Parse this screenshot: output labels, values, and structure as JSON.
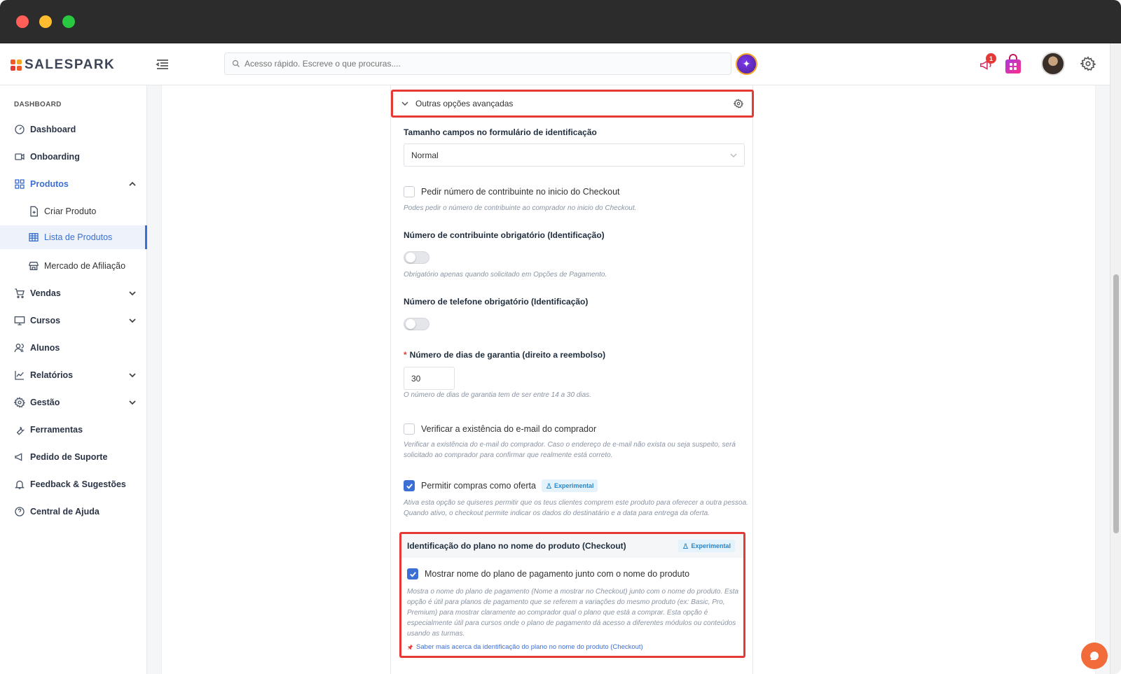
{
  "app": {
    "brand": "SALESPARK"
  },
  "topbar": {
    "search_placeholder": "Acesso rápido. Escreve o que procuras....",
    "notification_count": "1"
  },
  "sidebar": {
    "heading": "DASHBOARD",
    "items": [
      {
        "label": "Dashboard",
        "icon": "dashboard-icon"
      },
      {
        "label": "Onboarding",
        "icon": "video-icon"
      },
      {
        "label": "Produtos",
        "icon": "grid-icon",
        "expanded": true
      },
      {
        "label": "Criar Produto",
        "icon": "file-plus-icon"
      },
      {
        "label": "Lista de Produtos",
        "icon": "table-icon",
        "selected": true
      },
      {
        "label": "Mercado de Afiliação",
        "icon": "store-icon"
      },
      {
        "label": "Vendas",
        "icon": "cart-icon"
      },
      {
        "label": "Cursos",
        "icon": "monitor-icon"
      },
      {
        "label": "Alunos",
        "icon": "users-icon"
      },
      {
        "label": "Relatórios",
        "icon": "chart-icon"
      },
      {
        "label": "Gestão",
        "icon": "gear-icon"
      },
      {
        "label": "Ferramentas",
        "icon": "wrench-icon"
      },
      {
        "label": "Pedido de Suporte",
        "icon": "megaphone-icon"
      },
      {
        "label": "Feedback & Sugestões",
        "icon": "bell-icon"
      },
      {
        "label": "Central de Ajuda",
        "icon": "help-icon"
      }
    ]
  },
  "form": {
    "section_title": "Outras opções avançadas",
    "field_size": {
      "label": "Tamanho campos no formulário de identificação",
      "value": "Normal"
    },
    "ask_tax_number": {
      "label": "Pedir número de contribuinte no inicio do Checkout",
      "checked": false,
      "help": "Podes pedir o número de contribuinte ao comprador no inicio do Checkout."
    },
    "tax_required": {
      "label": "Número de contribuinte obrigatório (Identificação)",
      "enabled": false,
      "help": "Obrigatório apenas quando solicitado em Opções de Pagamento."
    },
    "phone_required": {
      "label": "Número de telefone obrigatório (Identificação)",
      "enabled": false
    },
    "guarantee_days": {
      "required_mark": "*",
      "label": "Número de dias de garantia (direito a reembolso)",
      "value": "30",
      "help": "O número de dias de garantia tem de ser entre 14 a 30 dias."
    },
    "verify_email": {
      "label": "Verificar a existência do e-mail do comprador",
      "checked": false,
      "help_line1": "Verificar a existência do e-mail do comprador. Caso o endereço de e-mail não exista ou seja suspeito, será",
      "help_line2": "solicitado ao comprador para confirmar que realmente está correto."
    },
    "gift_purchase": {
      "label": "Permitir compras como oferta",
      "checked": true,
      "tag": "Experimental",
      "help_line1": "Ativa esta opção se quiseres permitir que os teus clientes comprem este produto para oferecer a outra pessoa.",
      "help_line2": "Quando ativo, o checkout permite indicar os dados do destinatário e a data para entrega da oferta."
    },
    "plan_identification": {
      "title": "Identificação do plano no nome do produto (Checkout)",
      "tag": "Experimental",
      "checkbox_label": "Mostrar nome do plano de pagamento junto com o nome do produto",
      "checked": true,
      "help_lines": [
        "Mostra o nome do plano de pagamento (Nome a mostrar no Checkout) junto com o nome do produto. Esta",
        "opção é útil para planos de pagamento que se referem a variações do mesmo produto (ex: Basic, Pro,",
        "Premium) para mostrar claramente ao comprador qual o plano que está a comprar. Esta opção é",
        "especialmente útil para cursos onde o plano de pagamento dá acesso a diferentes módulos ou conteúdos",
        "usando as turmas."
      ],
      "link": "Saber mais acerca da identificação do plano no nome do produto (Checkout)"
    }
  },
  "colors": {
    "accent": "#3b6fd4",
    "highlight": "#e53935",
    "brand": "#f05a28"
  }
}
